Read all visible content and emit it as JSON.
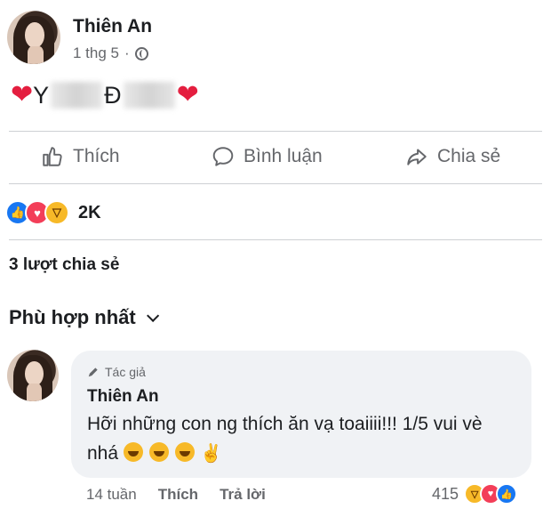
{
  "post": {
    "author": "Thiên An",
    "time": "1 thg 5",
    "separator": "·",
    "privacy_icon": "globe-icon",
    "text_start": "Y",
    "text_mid": "Đ"
  },
  "actions": {
    "like": "Thích",
    "comment": "Bình luận",
    "share": "Chia sẻ"
  },
  "stats": {
    "reaction_count": "2K",
    "shares": "3 lượt chia sẻ"
  },
  "sort": {
    "label": "Phù hợp nhất"
  },
  "comment": {
    "badge": "Tác giả",
    "author": "Thiên An",
    "text": "Hỡi những con ng thích ăn vạ toaiiii!!! 1/5 vui vè nhá",
    "time": "14 tuần",
    "like": "Thích",
    "reply": "Trả lời",
    "reaction_count": "415"
  },
  "colors": {
    "like_blue": "#1877f2",
    "love_red": "#f33e58",
    "haha_yellow": "#f7b928",
    "bubble_bg": "#f0f2f5",
    "muted_text": "#65676b"
  }
}
